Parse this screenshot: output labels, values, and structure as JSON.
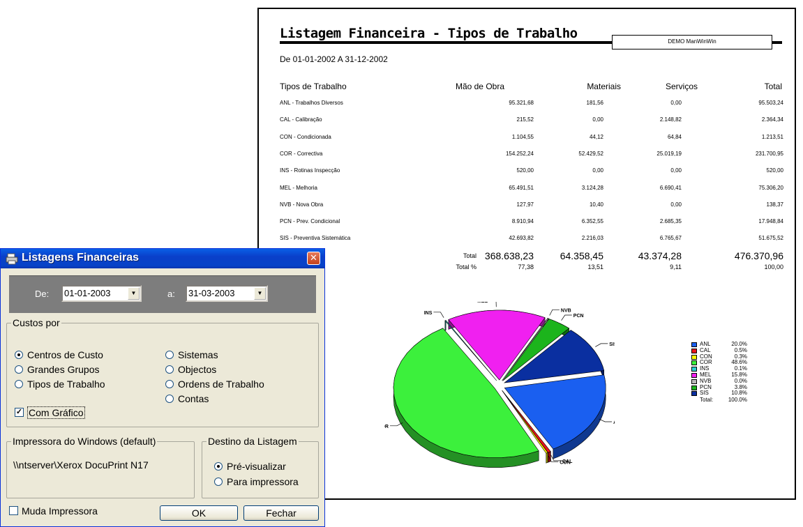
{
  "report": {
    "title": "Listagem Financeira - Tipos de Trabalho",
    "box_text": "DEMO ManWinWin",
    "period": "De 01-01-2002 A 31-12-2002",
    "headers": [
      "Tipos de Trabalho",
      "Mão de Obra",
      "Materiais",
      "Serviços",
      "Total"
    ],
    "rows": [
      [
        "ANL - Trabalhos Diversos",
        "95.321,68",
        "181,56",
        "0,00",
        "95.503,24"
      ],
      [
        "CAL - Calibração",
        "215,52",
        "0,00",
        "2.148,82",
        "2.364,34"
      ],
      [
        "CON - Condicionada",
        "1.104,55",
        "44,12",
        "64,84",
        "1.213,51"
      ],
      [
        "COR - Correctiva",
        "154.252,24",
        "52.429,52",
        "25.019,19",
        "231.700,95"
      ],
      [
        "INS - Rotinas Inspecção",
        "520,00",
        "0,00",
        "0,00",
        "520,00"
      ],
      [
        "MEL - Melhoria",
        "65.491,51",
        "3.124,28",
        "6.690,41",
        "75.306,20"
      ],
      [
        "NVB - Nova Obra",
        "127,97",
        "10,40",
        "0,00",
        "138,37"
      ],
      [
        "PCN - Prev. Condicional",
        "8.910,94",
        "6.352,55",
        "2.685,35",
        "17.948,84"
      ],
      [
        "SIS - Preventiva Sistemática",
        "42.693,82",
        "2.216,03",
        "6.765,67",
        "51.675,52"
      ]
    ],
    "total_label": "Total",
    "total": [
      "368.638,23",
      "64.358,45",
      "43.374,28",
      "476.370,96"
    ],
    "total_pct_label": "Total %",
    "total_pct": [
      "77,38",
      "13,51",
      "9,11",
      "100,00"
    ]
  },
  "chart_data": {
    "type": "pie",
    "categories": [
      "ANL",
      "CAL",
      "CON",
      "COR",
      "INS",
      "MEL",
      "NVB",
      "PCN",
      "SIS"
    ],
    "values": [
      20.0,
      0.5,
      0.3,
      48.6,
      0.1,
      15.8,
      0.0,
      3.8,
      10.8
    ],
    "legend_percent": [
      "20.0%",
      "0.5%",
      "0.3%",
      "48.6%",
      "0.1%",
      "15.8%",
      "0.0%",
      "3.8%",
      "10.8%"
    ],
    "colors": [
      "#1a5ff0",
      "#e8141a",
      "#ffff00",
      "#3cf03c",
      "#2cd0d0",
      "#f020f0",
      "#b8b8b8",
      "#1cb41c",
      "#0a2fa0"
    ],
    "total_label": "Total:",
    "total_value": "100.0%",
    "legend": "right"
  },
  "dialog": {
    "title": "Listagens Financeiras",
    "close_glyph": "✕",
    "from_label": "De:",
    "from_value": "01-01-2003",
    "to_label": "a:",
    "to_value": "31-03-2003",
    "dropdown_glyph": "▼",
    "costs_label": "Custos por",
    "options_left": [
      "Centros de Custo",
      "Grandes Grupos",
      "Tipos de Trabalho"
    ],
    "options_right": [
      "Sistemas",
      "Objectos",
      "Ordens de Trabalho",
      "Contas"
    ],
    "selected_option": "Centros de Custo",
    "chart_checkbox": "Com Gráfico",
    "chart_checkbox_checked": true,
    "printer_label": "Impressora do Windows (default)",
    "printer_value": "\\\\ntserver\\Xerox DocuPrint N17",
    "destination_label": "Destino da Listagem",
    "destination_options": [
      "Pré-visualizar",
      "Para impressora"
    ],
    "change_printer": "Muda Impressora",
    "ok": "OK",
    "close": "Fechar"
  }
}
